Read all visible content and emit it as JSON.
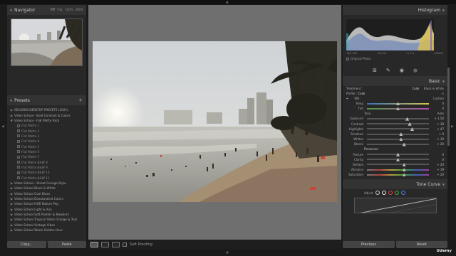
{
  "navigator": {
    "title": "Navigator",
    "zoom": [
      "FIT",
      "FILL",
      "100%",
      "300%"
    ]
  },
  "presets": {
    "title": "Presets",
    "add": "+",
    "items": [
      {
        "label": "SEASONS DESKTOP PRESETS (2021)",
        "kind": "folder"
      },
      {
        "label": "Video School - Bold Contrast & Colors",
        "kind": "folder"
      },
      {
        "label": "Video School - Flat Matte Pack",
        "kind": "open"
      },
      {
        "label": "Flat Matte 1",
        "kind": "sub"
      },
      {
        "label": "Flat Matte 2",
        "kind": "sub"
      },
      {
        "label": "Flat Matte 3",
        "kind": "sub"
      },
      {
        "label": "Flat Matte 4",
        "kind": "sub"
      },
      {
        "label": "Flat Matte 5",
        "kind": "sub"
      },
      {
        "label": "Flat Matte 6",
        "kind": "sub"
      },
      {
        "label": "Flat Matte 7",
        "kind": "sub"
      },
      {
        "label": "Flat Matte B&W 8",
        "kind": "sub"
      },
      {
        "label": "Flat Matte B&W 9",
        "kind": "sub"
      },
      {
        "label": "Flat Matte B&W 10",
        "kind": "sub"
      },
      {
        "label": "Flat Matte B&W 11",
        "kind": "sub"
      },
      {
        "label": "Video School - Street Grunge Style",
        "kind": "folder"
      },
      {
        "label": "Video School Black & White",
        "kind": "folder"
      },
      {
        "label": "Video School Cool Blues",
        "kind": "folder"
      },
      {
        "label": "Video School Desaturated Colors",
        "kind": "folder"
      },
      {
        "label": "Video School HDR Nature Pop",
        "kind": "folder"
      },
      {
        "label": "Video School Light & Airy",
        "kind": "folder"
      },
      {
        "label": "Video School Soft Pastels & Newborn",
        "kind": "folder"
      },
      {
        "label": "Video School Tropical Vibes Orange & Teal",
        "kind": "folder"
      },
      {
        "label": "Video School Vintage Vibes",
        "kind": "folder"
      },
      {
        "label": "Video School Warm Golden Hour",
        "kind": "folder"
      }
    ]
  },
  "left_buttons": {
    "copy": "Copy...",
    "paste": "Paste"
  },
  "toolbar": {
    "soft_proofing": "Soft Proofing"
  },
  "histogram": {
    "title": "Histogram",
    "iso": "ISO 125",
    "focal": "16 mm",
    "aperture": "f / 4.0",
    "shutter": "1/4000",
    "original_photo": "Original Photo"
  },
  "basic": {
    "title": "Basic",
    "treatment_label": "Treatment :",
    "color": "Color",
    "bw": "Black & White",
    "profile_label": "Profile :",
    "profile_value": "Color",
    "wb_label": "WB :",
    "wb_value": "Custom",
    "tone_label": "Tone",
    "auto": "Auto",
    "presence_label": "Presence",
    "sliders_wb": [
      {
        "label": "Temp",
        "value": "0",
        "pos": 0.5
      },
      {
        "label": "Tint",
        "value": "0",
        "pos": 0.5
      }
    ],
    "sliders_tone": [
      {
        "label": "Exposure",
        "value": "+ 1.50",
        "pos": 0.65
      },
      {
        "label": "Contrast",
        "value": "+ 38",
        "pos": 0.69
      },
      {
        "label": "Highlights",
        "value": "+ 47",
        "pos": 0.73
      },
      {
        "label": "Shadows",
        "value": "+ 9",
        "pos": 0.55
      },
      {
        "label": "Whites",
        "value": "+ 10",
        "pos": 0.55
      },
      {
        "label": "Blacks",
        "value": "+ 20",
        "pos": 0.6
      }
    ],
    "sliders_presence": [
      {
        "label": "Texture",
        "value": "0",
        "pos": 0.5
      },
      {
        "label": "Clarity",
        "value": "0",
        "pos": 0.5
      },
      {
        "label": "Dehaze",
        "value": "+ 20",
        "pos": 0.6
      },
      {
        "label": "Vibrance",
        "value": "+ 19",
        "pos": 0.6
      },
      {
        "label": "Saturation",
        "value": "+ 20",
        "pos": 0.6
      }
    ]
  },
  "tone_curve": {
    "title": "Tone Curve",
    "adjust": "Adjust"
  },
  "right_buttons": {
    "previous": "Previous",
    "reset": "Reset"
  },
  "watermark": "Udemy"
}
